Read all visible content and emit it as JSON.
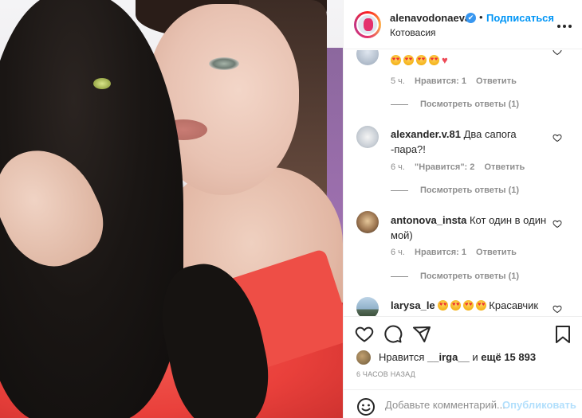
{
  "post": {
    "username": "alenavodonaeva",
    "verified_mark": "✔",
    "separator": "•",
    "follow_label": "Подписаться",
    "location": "Котовасия"
  },
  "comments": [
    {
      "username": "",
      "text": "",
      "emoji_count": 4,
      "extra": "♥",
      "time": "5 ч.",
      "likes": "Нравится: 1",
      "reply": "Ответить",
      "view_replies": "Посмотреть ответы (1)"
    },
    {
      "username": "alexander.v.81",
      "text": "Два сапога -пара?!",
      "time": "6 ч.",
      "likes": "\"Нравится\": 2",
      "reply": "Ответить",
      "view_replies": "Посмотреть ответы (1)"
    },
    {
      "username": "antonova_insta",
      "text": "Кот один в один мой)",
      "time": "6 ч.",
      "likes": "Нравится: 1",
      "reply": "Ответить",
      "view_replies": "Посмотреть ответы (1)"
    },
    {
      "username": "larysa_le",
      "text": "Красавчик",
      "emoji_count": 4
    }
  ],
  "likes": {
    "prefix": "Нравится",
    "user": "__irga__",
    "and": "и",
    "more": "ещё 15 893"
  },
  "timestamp": "6 ЧАСОВ НАЗАД",
  "add_comment": {
    "placeholder": "Добавьте комментарий...",
    "post_label": "Опубликовать"
  },
  "icons": [
    "more-icon",
    "heart-icon",
    "comment-icon",
    "share-icon",
    "bookmark-icon",
    "smile-icon"
  ],
  "colors": {
    "accent": "#0095f6",
    "muted": "#8e8e8e",
    "text": "#262626",
    "verified": "#3897f0"
  }
}
